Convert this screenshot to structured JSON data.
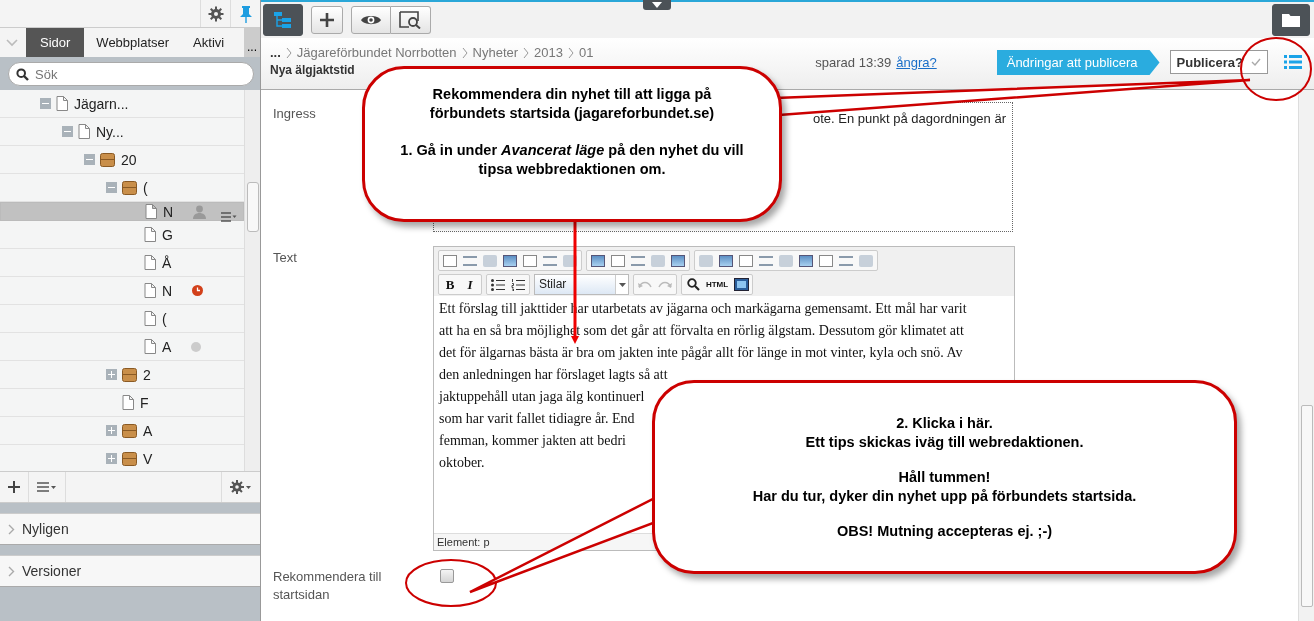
{
  "sidebar": {
    "tabs": [
      {
        "label": "Sidor",
        "selected": true
      },
      {
        "label": "Webbplatser",
        "selected": false
      },
      {
        "label": "Aktivi",
        "selected": false
      }
    ],
    "more_button": "...",
    "search": {
      "placeholder": "Sök"
    },
    "tree": [
      {
        "label": "Jägarn...",
        "kind": "page",
        "expanded": true,
        "selected": false,
        "children": [
          {
            "label": "Ny...",
            "kind": "page",
            "expanded": true,
            "selected": false,
            "children": [
              {
                "label": "20",
                "kind": "folder",
                "expanded": true,
                "selected": false,
                "children": [
                  {
                    "label": "(",
                    "kind": "folder",
                    "expanded": true,
                    "selected": false,
                    "children": [
                      {
                        "label": "N",
                        "kind": "page",
                        "selected": true,
                        "locked": true
                      },
                      {
                        "label": "G",
                        "kind": "page",
                        "selected": false
                      },
                      {
                        "label": "Å",
                        "kind": "page",
                        "selected": false
                      },
                      {
                        "label": "N",
                        "kind": "page",
                        "selected": false,
                        "scheduled": true
                      },
                      {
                        "label": "(",
                        "kind": "page",
                        "selected": false
                      },
                      {
                        "label": "A",
                        "kind": "page",
                        "selected": false,
                        "unpublished": true
                      }
                    ]
                  },
                  {
                    "label": "2",
                    "kind": "folder",
                    "expanded": false,
                    "selected": false
                  },
                  {
                    "label": "F",
                    "kind": "page",
                    "selected": false
                  },
                  {
                    "label": "A",
                    "kind": "folder",
                    "expanded": false,
                    "selected": false
                  },
                  {
                    "label": "V",
                    "kind": "folder",
                    "expanded": false,
                    "selected": false
                  }
                ]
              }
            ]
          }
        ]
      }
    ],
    "panels": [
      {
        "label": "Nyligen",
        "expanded": false
      },
      {
        "label": "Versioner",
        "expanded": false
      }
    ]
  },
  "header": {
    "breadcrumb": [
      "...",
      "Jägareförbundet Norrbotten",
      "Nyheter",
      "2013",
      "01"
    ],
    "title": "Nya älgjaktstid",
    "saved_status": "sparad 13:39",
    "undo_link": "ångra?",
    "changes_label": "Ändringar att publicera",
    "publish_button": "Publicera?"
  },
  "form": {
    "ingress": {
      "label": "Ingress",
      "value": "ote. En punkt på dagordningen är"
    },
    "text": {
      "label": "Text",
      "toolbar": {
        "bold": "B",
        "italic": "I",
        "style_select": "Stilar",
        "html": "HTML"
      },
      "lines": [
        "Ett förslag till jakttider har utarbetats av jägarna och markägarna gemensamt. Ett mål har varit",
        "att ha en så bra möjlighet som det går att förvalta en rörlig älgstam. Dessutom gör klimatet att",
        "det för älgarnas bästa är bra om jakten inte pågår allt för länge in mot vinter, kyla och snö. Av",
        "den anledningen har förslaget lagts så att",
        "jaktuppehåll utan jaga älg kontinuerl",
        "som har varit fallet tidiagre år. End",
        "femman, kommer jakten att bedri",
        "oktober."
      ],
      "status": "Element: p"
    },
    "recommend": {
      "label": "Rekommendera till startsidan",
      "checked": false
    }
  },
  "callouts": [
    {
      "paragraphs": [
        [
          "Rekommendera din nyhet till att ligga på",
          "förbundets startsida (jagareforbundet.se)"
        ],
        [
          "1. Gå in under *Avancerat läge* på den nyhet du vill",
          "tipsa webbredaktionen om."
        ]
      ]
    },
    {
      "paragraphs": [
        [
          "2. Klicka i här.",
          "Ett tips skickas iväg till webredaktionen."
        ],
        [
          "Håll tummen!",
          "Har du tur, dyker din nyhet upp på förbundets startsida."
        ],
        [
          "OBS! Mutning accepteras ej. ;-)"
        ]
      ]
    }
  ]
}
